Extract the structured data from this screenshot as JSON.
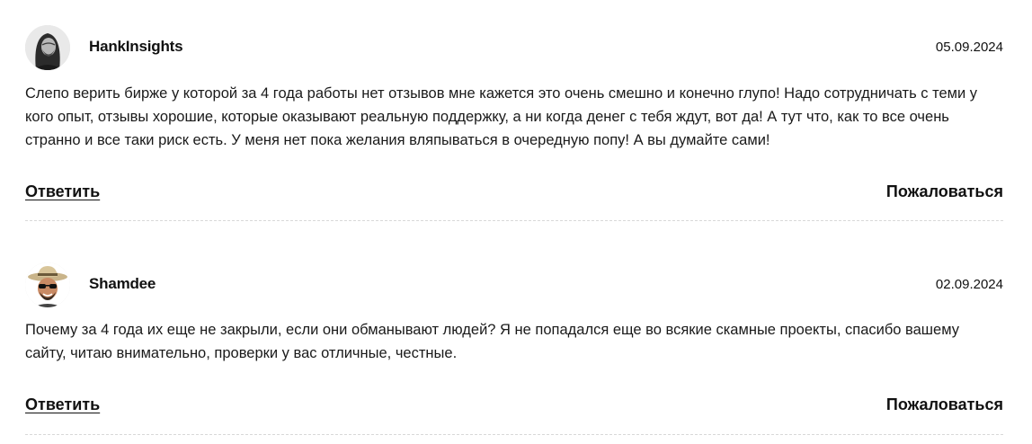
{
  "comments": [
    {
      "author": "HankInsights",
      "date": "05.09.2024",
      "text": "Слепо верить бирже у которой за 4 года работы нет отзывов мне кажется это очень смешно и конечно глупо! Надо сотрудничать с теми у кого опыт, отзывы хорошие, которые оказывают реальную поддержку, а ни когда денег с тебя ждут, вот да! А тут что, как то все очень странно и все таки риск есть. У меня нет пока желания вляпываться в очередную попу! А вы думайте сами!",
      "reply_label": "Ответить",
      "report_label": "Пожаловаться",
      "avatar_icon": "avatar-man-long-hair-bw"
    },
    {
      "author": "Shamdee",
      "date": "02.09.2024",
      "text": "Почему за 4 года их еще не закрыли, если они обманывают людей? Я не попадался еще во всякие скамные проекты, спасибо вашему сайту, читаю внимательно, проверки у вас отличные, честные.",
      "reply_label": "Ответить",
      "report_label": "Пожаловаться",
      "avatar_icon": "avatar-man-hat-sunglasses"
    }
  ],
  "colors": {
    "text": "#1a1a1a",
    "divider": "#d8d8d8",
    "background": "#ffffff"
  }
}
